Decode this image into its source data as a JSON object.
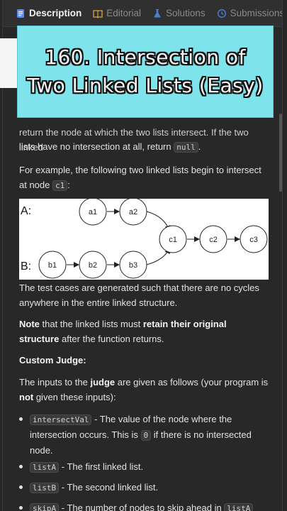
{
  "tabs": [
    {
      "label": "Description",
      "icon": "document-icon",
      "active": true
    },
    {
      "label": "Editorial",
      "icon": "book-icon",
      "active": false
    },
    {
      "label": "Solutions",
      "icon": "flask-icon",
      "active": false
    },
    {
      "label": "Submissions",
      "icon": "history-icon",
      "active": false
    }
  ],
  "banner": {
    "line1": "160. Intersection of",
    "line2": "Two Linked Lists (Easy)"
  },
  "content": {
    "cutoff_line": "return the node at which the two lists intersect. If the two linked",
    "p1_text": "lists have no intersection at all, return ",
    "p1_code": "null",
    "p1_end": ".",
    "p2_text": "For example, the following two linked lists begin to intersect at node ",
    "p2_code": "c1",
    "p2_end": ":",
    "p3": "The test cases are generated such that there are no cycles anywhere in the entire linked structure.",
    "p4_bold1": "Note",
    "p4_mid": " that the linked lists must ",
    "p4_bold2": "retain their original structure",
    "p4_end": " after the function returns.",
    "custom_judge": "Custom Judge:",
    "p5_start": "The inputs to the ",
    "p5_bold1": "judge",
    "p5_mid": " are given as follows (your program is ",
    "p5_bold2": "not",
    "p5_end": " given these inputs):",
    "bullets": [
      {
        "code": "intersectVal",
        "text": " - The value of the node where the intersection occurs. This is ",
        "code2": "0",
        "text2": " if there is no intersected node."
      },
      {
        "code": "listA",
        "text": " - The first linked list."
      },
      {
        "code": "listB",
        "text": " - The second linked list."
      },
      {
        "code": "skipA",
        "text": " - The number of nodes to skip ahead in ",
        "code2": "listA"
      }
    ]
  },
  "diagram": {
    "label_a": "A:",
    "label_b": "B:",
    "nodes_a": [
      "a1",
      "a2"
    ],
    "nodes_b": [
      "b1",
      "b2",
      "b3"
    ],
    "nodes_c": [
      "c1",
      "c2",
      "c3"
    ]
  }
}
